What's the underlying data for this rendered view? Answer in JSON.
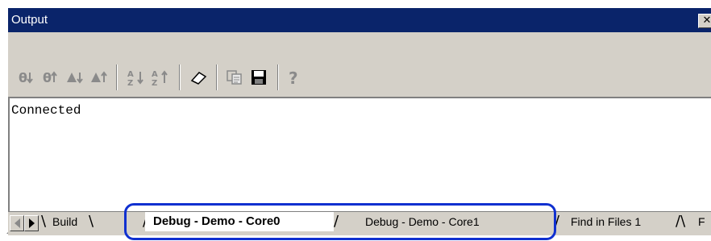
{
  "window": {
    "title": "Output",
    "close_label": "✕"
  },
  "toolbar": {
    "buttons": [
      {
        "icon": "go-to-next-error-icon"
      },
      {
        "icon": "go-to-previous-error-icon"
      },
      {
        "icon": "go-to-next-warning-icon"
      },
      {
        "icon": "go-to-previous-warning-icon"
      },
      {
        "icon": "sort-ascending-icon"
      },
      {
        "icon": "sort-descending-icon"
      },
      {
        "icon": "clear-eraser-icon"
      },
      {
        "icon": "copy-icon"
      },
      {
        "icon": "save-icon"
      },
      {
        "icon": "help-icon"
      }
    ]
  },
  "output": {
    "lines": [
      "Connected"
    ]
  },
  "tabs": [
    {
      "label": "Build",
      "active": false
    },
    {
      "label": "Debug - Demo - Core0",
      "active": true
    },
    {
      "label": "Debug - Demo - Core1",
      "active": false
    },
    {
      "label": "Find in Files 1",
      "active": false
    },
    {
      "label": "F",
      "active": false
    }
  ],
  "colors": {
    "title_bar": "#0a246a",
    "highlight": "#1030d0",
    "face": "#d4d0c8"
  }
}
